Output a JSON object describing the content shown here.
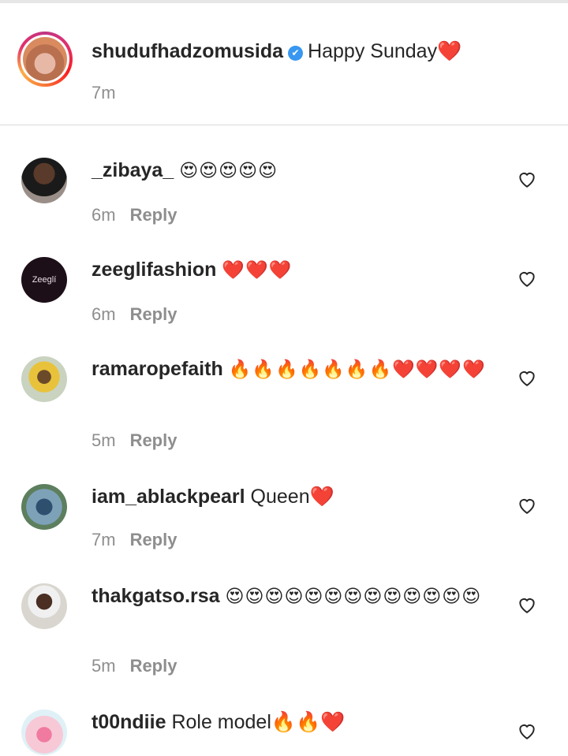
{
  "caption": {
    "username": "shudufhadzomusida",
    "text": "Happy Sunday❤️",
    "time": "7m",
    "verified_icon": "✔"
  },
  "reply_label": "Reply",
  "comments": [
    {
      "username": "_zibaya_",
      "text": "😍😍😍😍😍",
      "time": "6m"
    },
    {
      "username": "zeeglifashion",
      "text": "❤️❤️❤️",
      "time": "6m",
      "avatar_text": "Zeeglí"
    },
    {
      "username": "ramaropefaith",
      "text": "🔥🔥🔥🔥🔥🔥🔥❤️❤️❤️❤️",
      "time": "5m"
    },
    {
      "username": "iam_ablackpearl",
      "text": "Queen❤️",
      "time": "7m"
    },
    {
      "username": "thakgatso.rsa",
      "text": "😍😍😍😍😍😍😍😍😍😍😍😍😍",
      "time": "5m"
    },
    {
      "username": "t00ndiie",
      "text": "Role model🔥🔥❤️",
      "time": ""
    }
  ],
  "colors": {
    "verified": "#3897f0",
    "meta": "#8e8e8e",
    "text": "#262626"
  }
}
